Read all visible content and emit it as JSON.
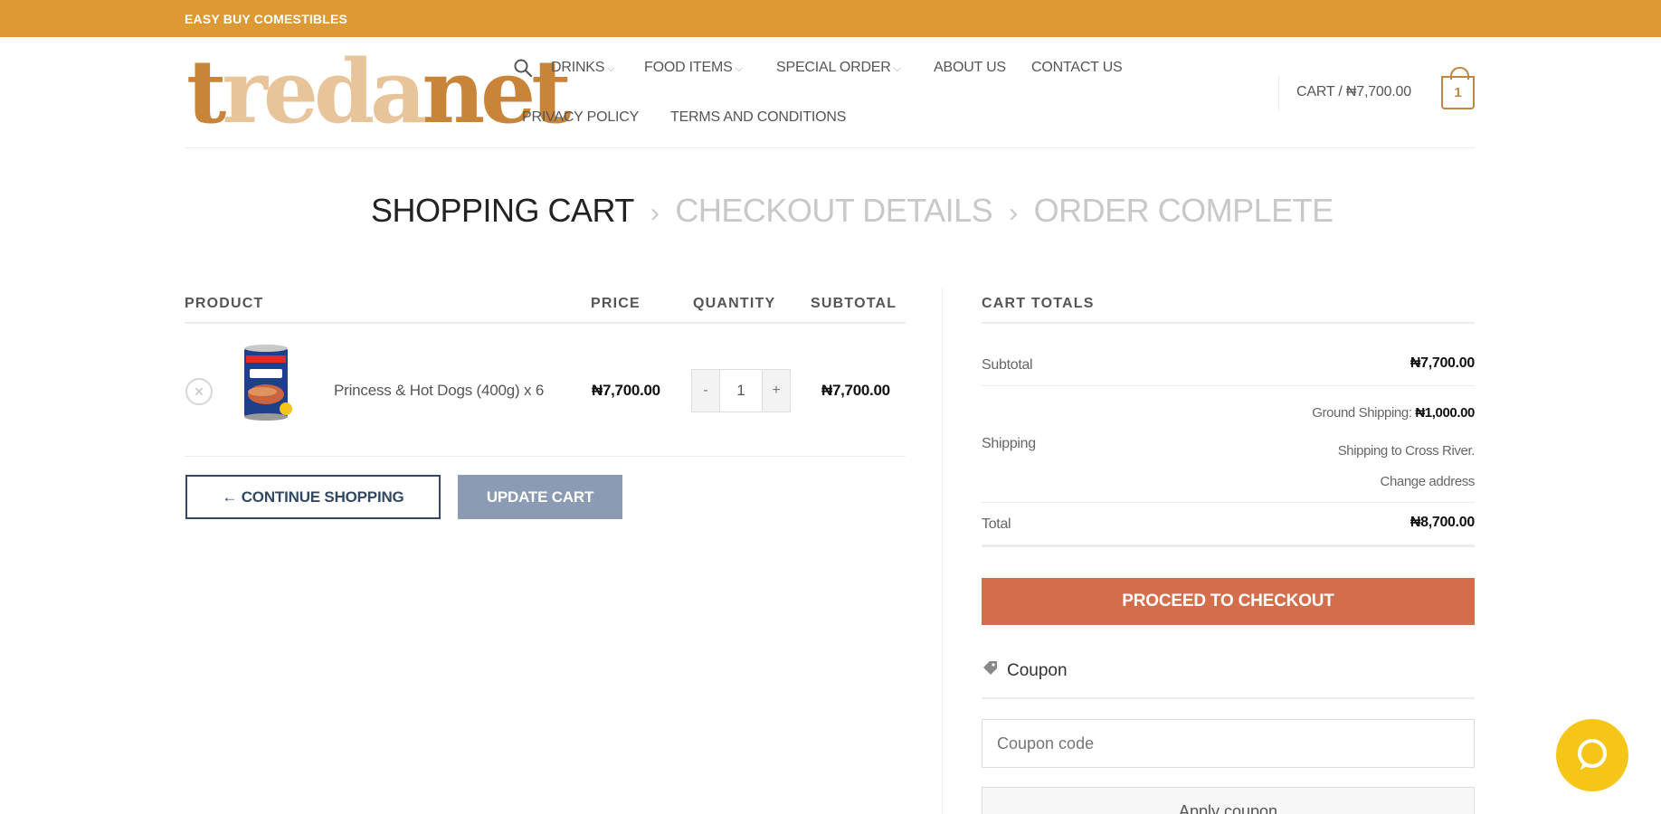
{
  "topbar": {
    "text": "EASY BUY COMESTIBLES"
  },
  "brand": {
    "logo_parts": [
      "t",
      "reda",
      "net"
    ],
    "colors": {
      "topbar": "#dd9933",
      "checkout": "#d26e4b",
      "update": "#8a9bb3",
      "chat": "#f5c518"
    }
  },
  "nav": {
    "search_icon": "search-icon",
    "row1": [
      {
        "label": "DRINKS",
        "has_dropdown": true
      },
      {
        "label": "FOOD ITEMS",
        "has_dropdown": true
      },
      {
        "label": "SPECIAL ORDER",
        "has_dropdown": true
      },
      {
        "label": "ABOUT US",
        "has_dropdown": false
      },
      {
        "label": "CONTACT US",
        "has_dropdown": false
      }
    ],
    "row2": [
      {
        "label": "PRIVACY POLICY"
      },
      {
        "label": "TERMS AND CONDITIONS"
      }
    ],
    "cart_label": "CART / ₦7,700.00",
    "cart_count": "1"
  },
  "breadcrumb": {
    "step1": "SHOPPING CART",
    "step2": "CHECKOUT DETAILS",
    "step3": "ORDER COMPLETE",
    "separator": "›"
  },
  "cart_table": {
    "headers": {
      "product": "PRODUCT",
      "price": "PRICE",
      "quantity": "QUANTITY",
      "subtotal": "SUBTOTAL"
    },
    "rows": [
      {
        "name": "Princess & Hot Dogs (400g) x 6",
        "price": "₦7,700.00",
        "quantity": "1",
        "subtotal": "₦7,700.00"
      }
    ],
    "remove_symbol": "×",
    "qty_minus": "-",
    "qty_plus": "+"
  },
  "actions": {
    "continue": "← CONTINUE SHOPPING",
    "update": "UPDATE CART"
  },
  "totals": {
    "heading": "CART TOTALS",
    "subtotal_label": "Subtotal",
    "subtotal_value": "₦7,700.00",
    "shipping_label": "Shipping",
    "shipping_method": "Ground Shipping:",
    "shipping_cost": "₦1,000.00",
    "shipping_to": "Shipping to Cross River.",
    "change_address": "Change address",
    "total_label": "Total",
    "total_value": "₦8,700.00",
    "checkout": "PROCEED TO CHECKOUT"
  },
  "coupon": {
    "heading": "Coupon",
    "placeholder": "Coupon code",
    "apply": "Apply coupon"
  }
}
